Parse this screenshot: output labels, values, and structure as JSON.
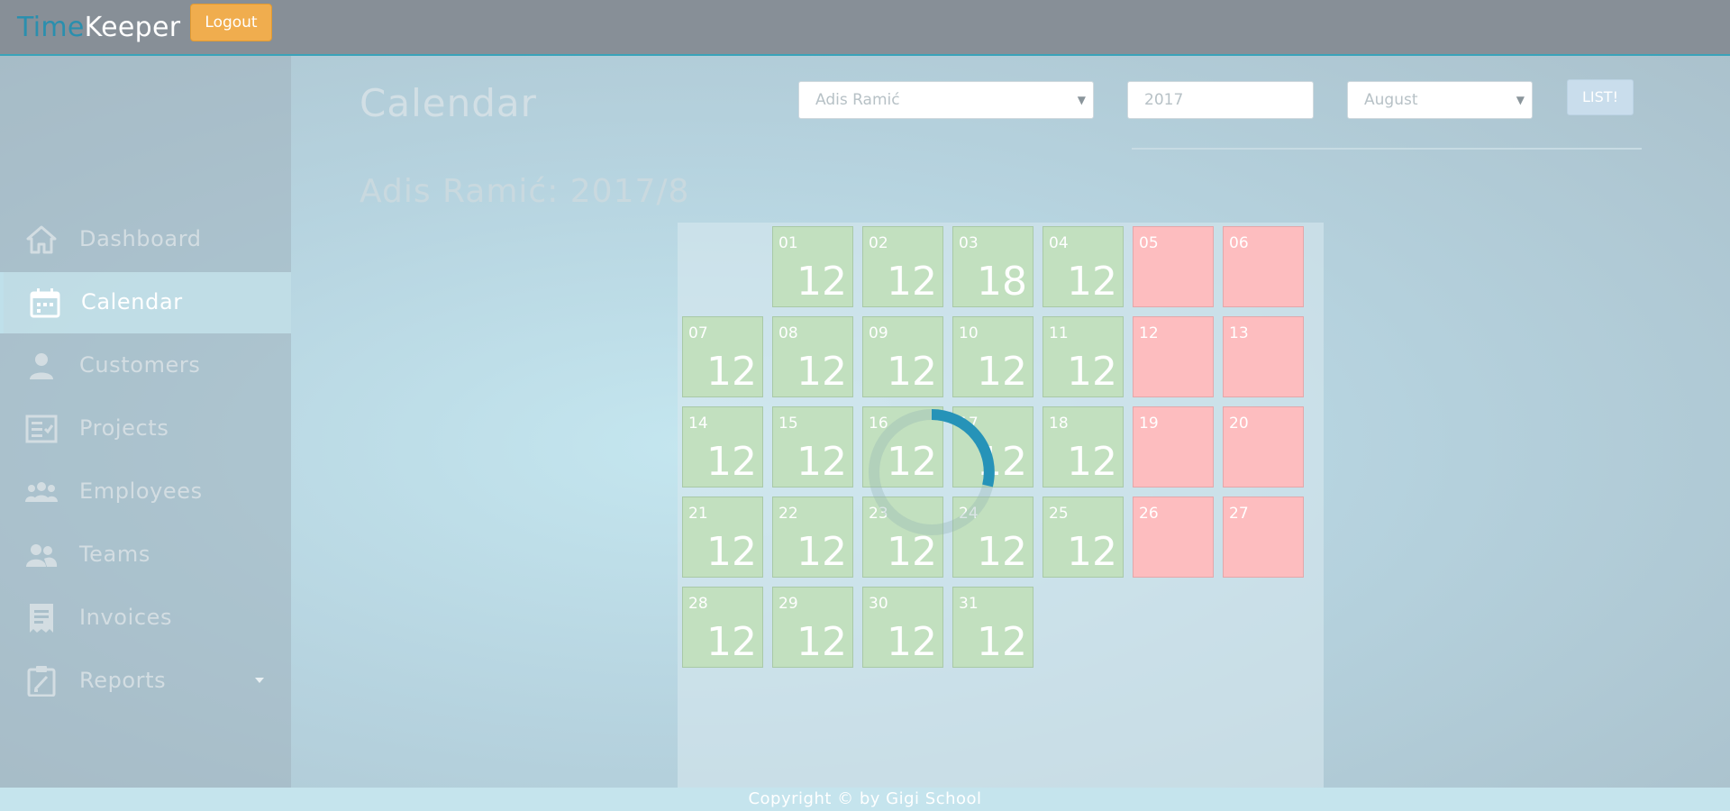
{
  "app": {
    "brand_part1": "Time",
    "brand_part2": "Keeper",
    "logout_label": "Logout"
  },
  "sidebar": {
    "items": [
      {
        "label": "Dashboard",
        "icon": "home-icon"
      },
      {
        "label": "Calendar",
        "icon": "calendar-icon",
        "active": true
      },
      {
        "label": "Customers",
        "icon": "person-icon"
      },
      {
        "label": "Projects",
        "icon": "checklist-icon"
      },
      {
        "label": "Employees",
        "icon": "people-group-icon"
      },
      {
        "label": "Teams",
        "icon": "team-icon"
      },
      {
        "label": "Invoices",
        "icon": "receipt-icon"
      },
      {
        "label": "Reports",
        "icon": "clipboard-icon",
        "has_dropdown": true
      }
    ]
  },
  "main": {
    "title": "Calendar",
    "subtitle": "Adis Ramić: 2017/8",
    "filters": {
      "employee": "Adis Ramić",
      "year": "2017",
      "month": "August",
      "list_button": "LIST!"
    }
  },
  "calendar": {
    "days": [
      {
        "day": "01",
        "hours": "12",
        "type": "work"
      },
      {
        "day": "02",
        "hours": "12",
        "type": "work"
      },
      {
        "day": "03",
        "hours": "18",
        "type": "work"
      },
      {
        "day": "04",
        "hours": "12",
        "type": "work"
      },
      {
        "day": "05",
        "hours": "",
        "type": "off"
      },
      {
        "day": "06",
        "hours": "",
        "type": "off"
      },
      {
        "day": "07",
        "hours": "12",
        "type": "work"
      },
      {
        "day": "08",
        "hours": "12",
        "type": "work"
      },
      {
        "day": "09",
        "hours": "12",
        "type": "work"
      },
      {
        "day": "10",
        "hours": "12",
        "type": "work"
      },
      {
        "day": "11",
        "hours": "12",
        "type": "work"
      },
      {
        "day": "12",
        "hours": "",
        "type": "off"
      },
      {
        "day": "13",
        "hours": "",
        "type": "off"
      },
      {
        "day": "14",
        "hours": "12",
        "type": "work"
      },
      {
        "day": "15",
        "hours": "12",
        "type": "work"
      },
      {
        "day": "16",
        "hours": "12",
        "type": "work"
      },
      {
        "day": "17",
        "hours": "12",
        "type": "work"
      },
      {
        "day": "18",
        "hours": "12",
        "type": "work"
      },
      {
        "day": "19",
        "hours": "",
        "type": "off"
      },
      {
        "day": "20",
        "hours": "",
        "type": "off"
      },
      {
        "day": "21",
        "hours": "12",
        "type": "work"
      },
      {
        "day": "22",
        "hours": "12",
        "type": "work"
      },
      {
        "day": "23",
        "hours": "12",
        "type": "work"
      },
      {
        "day": "24",
        "hours": "12",
        "type": "work"
      },
      {
        "day": "25",
        "hours": "12",
        "type": "work"
      },
      {
        "day": "26",
        "hours": "",
        "type": "off"
      },
      {
        "day": "27",
        "hours": "",
        "type": "off"
      },
      {
        "day": "28",
        "hours": "12",
        "type": "work"
      },
      {
        "day": "29",
        "hours": "12",
        "type": "work"
      },
      {
        "day": "30",
        "hours": "12",
        "type": "work"
      },
      {
        "day": "31",
        "hours": "12",
        "type": "work"
      }
    ]
  },
  "footer": {
    "text": "Copyright © by Gigi School"
  },
  "colors": {
    "work_day": "#c2e0bf",
    "off_day": "#fdbdbf",
    "accent": "#2a8fae",
    "logout": "#f0ad4e"
  }
}
